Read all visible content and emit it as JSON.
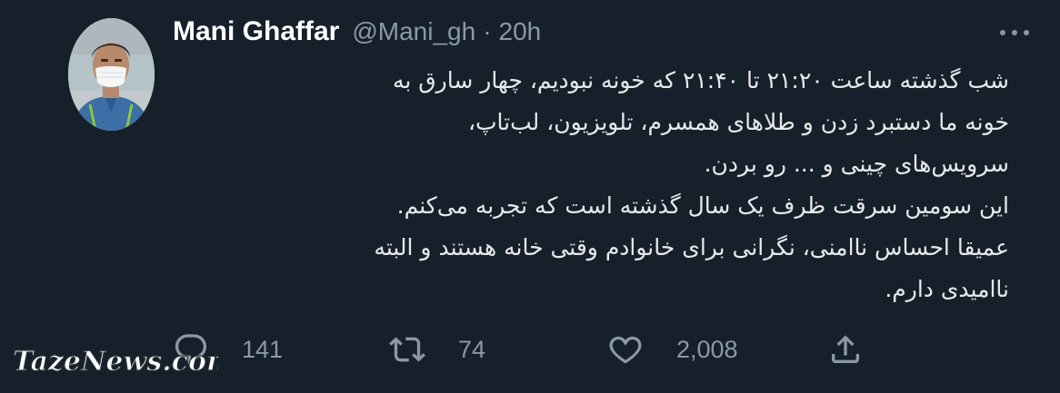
{
  "tweet": {
    "display_name": "Mani Ghaffar",
    "handle": "@Mani_gh",
    "separator": "·",
    "time": "20h",
    "lines": [
      "شب گذشته ساعت ۲۱:۲۰ تا ۲۱:۴۰ که خونه نبودیم، چهار سارق به",
      "خونه ما دستبرد زدن و طلاهای همسرم، تلویزیون، لب‌تاپ،",
      "سرویس‌های چینی و ... رو بردن.",
      "این سومین سرقت ظرف یک سال گذشته است که تجربه می‌کنم.",
      "عمیقا احساس ناامنی، نگرانی برای خانوادم وقتی خانه هستند و البته",
      "ناامیدی دارم."
    ]
  },
  "actions": {
    "reply": {
      "icon": "reply-icon",
      "count": "141"
    },
    "retweet": {
      "icon": "retweet-icon",
      "count": "74"
    },
    "like": {
      "icon": "heart-icon",
      "count": "2,008"
    },
    "share": {
      "icon": "share-icon"
    }
  },
  "watermark": "TazeNews.com",
  "colors": {
    "background": "#15202b",
    "text": "#e7e9ea",
    "muted": "#8b98a5"
  }
}
